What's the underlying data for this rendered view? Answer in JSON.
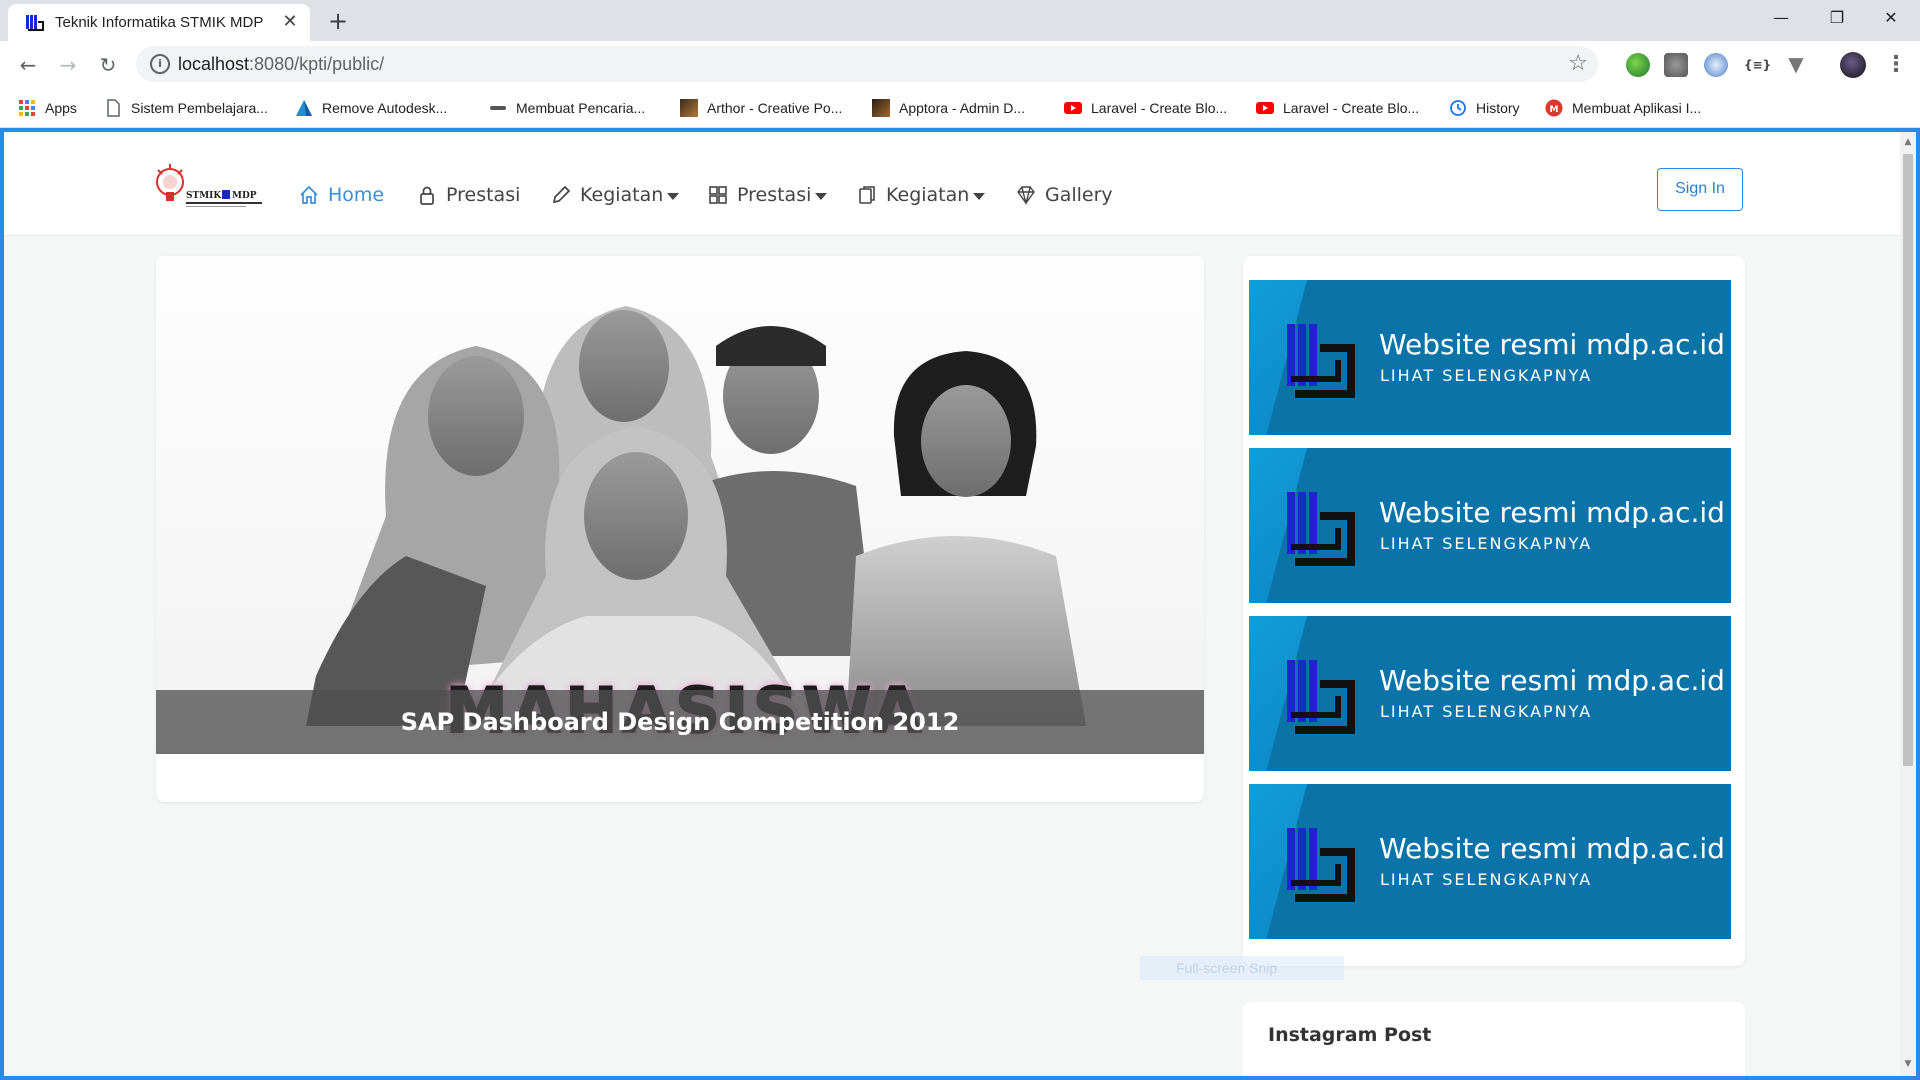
{
  "browser": {
    "tab_title": "Teknik Informatika STMIK MDP",
    "tab_close": "✕",
    "new_tab": "+",
    "url_host": "localhost",
    "url_rest": ":8080/kpti/public/",
    "window_controls": {
      "minimize": "—",
      "maximize": "❐",
      "close": "✕"
    }
  },
  "bookmarks": [
    {
      "label": "Apps",
      "icon": "apps-grid-icon"
    },
    {
      "label": "Sistem Pembelajara...",
      "icon": "page-icon"
    },
    {
      "label": "Remove Autodesk...",
      "icon": "autodesk-icon"
    },
    {
      "label": "Membuat Pencaria...",
      "icon": "dash-icon"
    },
    {
      "label": "Arthor - Creative Po...",
      "icon": "thumb-icon"
    },
    {
      "label": "Apptora - Admin D...",
      "icon": "thumb-icon"
    },
    {
      "label": "Laravel - Create Blo...",
      "icon": "youtube-icon"
    },
    {
      "label": "Laravel - Create Blo...",
      "icon": "youtube-icon"
    },
    {
      "label": "History",
      "icon": "history-icon"
    },
    {
      "label": "Membuat Aplikasi I...",
      "icon": "badge-icon"
    }
  ],
  "site": {
    "nav": [
      {
        "label": "Home",
        "icon": "home-icon",
        "dropdown": false,
        "active": true
      },
      {
        "label": "Prestasi",
        "icon": "lock-icon",
        "dropdown": false,
        "active": false
      },
      {
        "label": "Kegiatan",
        "icon": "pencil-icon",
        "dropdown": true,
        "active": false
      },
      {
        "label": "Prestasi",
        "icon": "grid-icon",
        "dropdown": true,
        "active": false
      },
      {
        "label": "Kegiatan",
        "icon": "clipboard-icon",
        "dropdown": true,
        "active": false
      },
      {
        "label": "Gallery",
        "icon": "diamond-icon",
        "dropdown": false,
        "active": false
      }
    ],
    "sign_in": "Sign In",
    "hero": {
      "banner_text": "MAHASISWA PENGUSAHA",
      "caption": "SAP Dashboard Design Competition 2012"
    },
    "promos": [
      {
        "title": "Website resmi mdp.ac.id",
        "subtitle": "LIHAT SELENGKAPNYA"
      },
      {
        "title": "Website resmi mdp.ac.id",
        "subtitle": "LIHAT SELENGKAPNYA"
      },
      {
        "title": "Website resmi mdp.ac.id",
        "subtitle": "LIHAT SELENGKAPNYA"
      },
      {
        "title": "Website resmi mdp.ac.id",
        "subtitle": "LIHAT SELENGKAPNYA"
      }
    ],
    "instagram_title": "Instagram Post",
    "snip_overlay": "Full-screen Snip"
  },
  "colors": {
    "accent": "#2b8ae6",
    "nav_active": "#3a8fd8",
    "promo_bg": "#0a73a8"
  }
}
